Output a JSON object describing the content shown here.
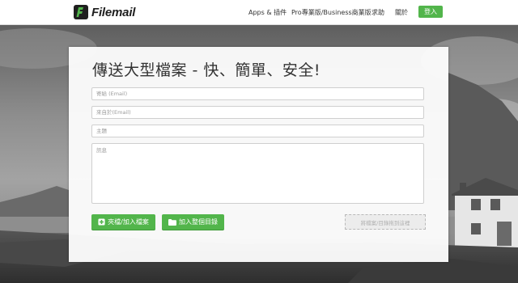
{
  "brand": {
    "name": "Filemail"
  },
  "nav": {
    "items": [
      "Apps & 插件",
      "Pro專業版/Business商業版",
      "求助",
      "關於"
    ],
    "login_label": "登入"
  },
  "upload": {
    "title": "傳送大型檔案 - 快、簡單、安全!",
    "to_placeholder": "寄給 (Email)",
    "from_placeholder": "來自於(Email)",
    "subject_placeholder": "主題",
    "message_placeholder": "訊息",
    "add_files_label": "夾檔/加入檔案",
    "add_folder_label": "加入整個目錄",
    "drop_hint": "將檔案/目錄拖到這裡"
  },
  "colors": {
    "accent": "#52b54b",
    "text": "#333333"
  },
  "icons": {
    "add_files": "plus-circle-icon",
    "add_folder": "folder-icon",
    "logo": "filemail-logo-icon"
  }
}
